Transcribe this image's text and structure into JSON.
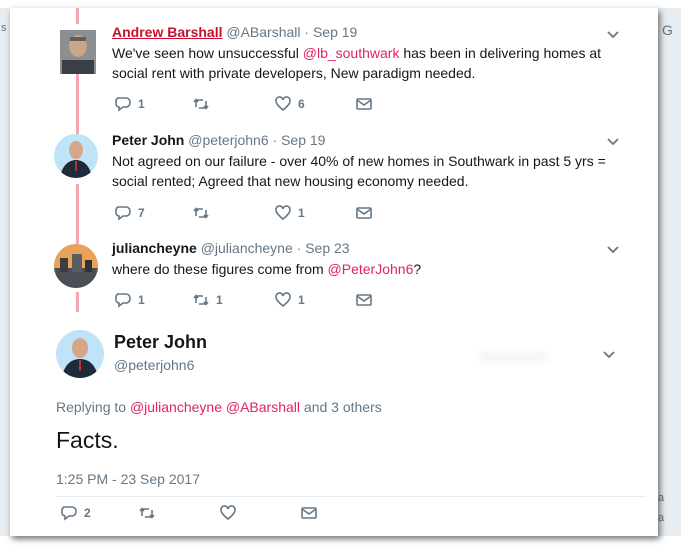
{
  "tweets": [
    {
      "fullname": "Andrew Barshall",
      "handle": "@ABarshall",
      "date": "· Sep 19",
      "text_pre": "We've seen how unsuccessful ",
      "mention": "@lb_southwark",
      "text_post": " has been in delivering homes at social rent with private developers,  New paradigm needed.",
      "reply_count": "1",
      "retweet_count": "",
      "like_count": "6"
    },
    {
      "fullname": "Peter John",
      "handle": "@peterjohn6",
      "date": "· Sep 19",
      "text": "Not agreed on our failure - over 40% of new homes in Southwark in past 5 yrs = social rented; Agreed that new housing economy needed.",
      "reply_count": "7",
      "retweet_count": "",
      "like_count": "1"
    },
    {
      "fullname": "juliancheyne",
      "handle": "@juliancheyne",
      "date": "· Sep 23",
      "text_pre": "where do these figures come from ",
      "mention": "@PeterJohn6",
      "text_post": "?",
      "reply_count": "1",
      "retweet_count": "1",
      "like_count": "1"
    }
  ],
  "main_tweet": {
    "fullname": "Peter John",
    "handle": "@peterjohn6",
    "replying_label": "Replying to",
    "replying_mentions": "@juliancheyne @ABarshall",
    "replying_others": "and 3 others",
    "text": "Facts.",
    "timestamp": "1:25 PM - 23 Sep 2017",
    "reply_count": "2",
    "retweet_count": "",
    "like_count": ""
  },
  "edge_glyphs": {
    "left_top": "s",
    "right_top": "G",
    "right_bottom_1": "a",
    "right_bottom_2": "a"
  },
  "colors": {
    "mention": "#e0245e",
    "thread_line": "#f4a7b0",
    "meta": "#657786",
    "text": "#14171a"
  },
  "icons": [
    "reply-icon",
    "retweet-icon",
    "heart-icon",
    "mail-icon",
    "chevron-down-icon"
  ]
}
